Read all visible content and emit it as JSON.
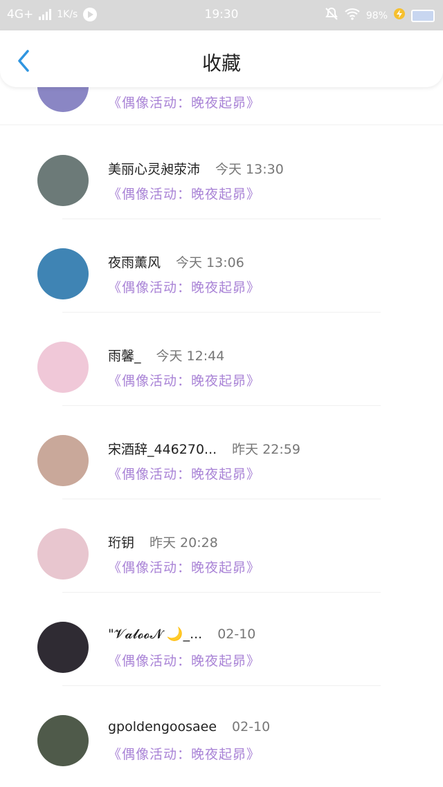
{
  "status_bar": {
    "network": "4G+",
    "speed": "1K/s",
    "time": "19:30",
    "battery": "98%"
  },
  "header": {
    "title": "收藏"
  },
  "top_partial": {
    "link": "《偶像活动：晚夜起昴》"
  },
  "items": [
    {
      "name": "美丽心灵昶荥沛",
      "time": "今天 13:30",
      "link": "《偶像活动：晚夜起昴》",
      "avatar_color": "#6c7a78"
    },
    {
      "name": "夜雨薰风",
      "time": "今天 13:06",
      "link": "《偶像活动：晚夜起昴》",
      "avatar_color": "#3f84b4"
    },
    {
      "name": "雨馨_",
      "time": "今天 12:44",
      "link": "《偶像活动：晚夜起昴》",
      "avatar_color": "#f0c8d8"
    },
    {
      "name": "宋酒辞_446270...",
      "time": "昨天 22:59",
      "link": "《偶像活动：晚夜起昴》",
      "avatar_color": "#c9a89a"
    },
    {
      "name": "珩钥",
      "time": "昨天 20:28",
      "link": "《偶像活动：晚夜起昴》",
      "avatar_color": "#e8c6cf"
    },
    {
      "name": "\"𝓥𝓪𝓵𝓸𝓸𝓝 🌙_...",
      "time": "02-10",
      "link": "《偶像活动：晚夜起昴》",
      "avatar_color": "#2f2b33"
    },
    {
      "name": "gpoldengoosaee",
      "time": "02-10",
      "link": "《偶像活动：晚夜起昴》",
      "avatar_color": "#4f5a4a"
    }
  ],
  "colors": {
    "accent": "#2f95e0",
    "link": "#a983d6"
  }
}
